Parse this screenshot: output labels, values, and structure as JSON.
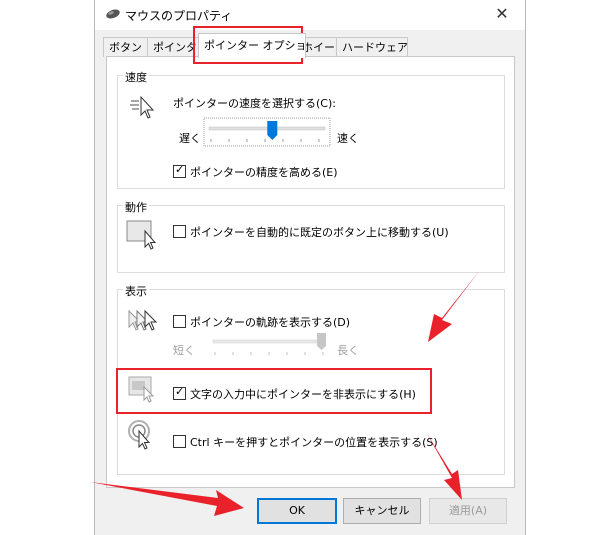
{
  "window": {
    "title": "マウスのプロパティ",
    "close_glyph": "✕"
  },
  "tabs": [
    {
      "label": "ボタン"
    },
    {
      "label": "ポインター"
    },
    {
      "label": "ポインター オプション",
      "active": true
    },
    {
      "label": "ホイール"
    },
    {
      "label": "ハードウェア"
    }
  ],
  "speed": {
    "group": "速度",
    "prompt": "ポインターの速度を選択する(C):",
    "slow": "遅く",
    "fast": "速く",
    "level": 0.55,
    "precision_label": "ポインターの精度を高める(E)",
    "precision_checked": true
  },
  "motion": {
    "group": "動作",
    "snap_label": "ポインターを自動的に既定のボタン上に移動する(U)",
    "snap_checked": false
  },
  "display": {
    "group": "表示",
    "trails_label": "ポインターの軌跡を表示する(D)",
    "trails_checked": false,
    "short": "短く",
    "long": "長く",
    "trails_level": 1.0,
    "hide_label": "文字の入力中にポインターを非表示にする(H)",
    "hide_checked": true,
    "ctrl_label": "Ctrl キーを押すとポインターの位置を表示する(S)",
    "ctrl_checked": false
  },
  "buttons": {
    "ok": "OK",
    "cancel": "キャンセル",
    "apply": "適用(A)"
  },
  "colors": {
    "accent": "#0078d7",
    "annotation": "#e8212a"
  },
  "icons": [
    "mouse-icon",
    "speed-cursor-icon",
    "snap-to-button-icon",
    "pointer-trails-icon",
    "hide-pointer-icon",
    "locate-pointer-icon"
  ]
}
